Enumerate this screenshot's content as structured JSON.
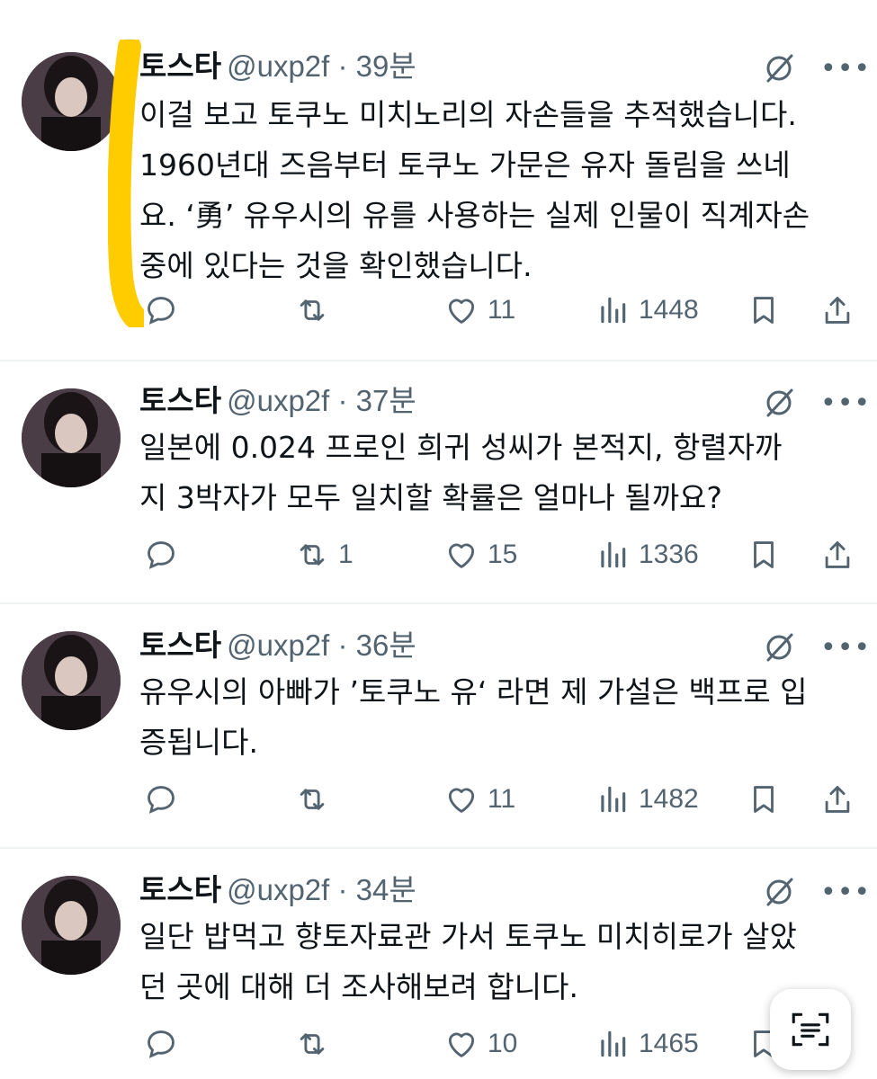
{
  "tweets": [
    {
      "name": "토스타",
      "meta": "@uxp2f · 39분",
      "text_lines": [
        "이걸 보고 토쿠노 미치노리의 자손들을 추적했습니다.",
        "1960년대 즈음부터 토쿠노 가문은 유자 돌림을 쓰네",
        "요. ‘勇’ 유우시의 유를 사용하는 실제 인물이 직계자손",
        "중에 있다는 것을 확인했습니다."
      ],
      "replies": "",
      "retweets": "",
      "likes": "11",
      "views": "1448"
    },
    {
      "name": "토스타",
      "meta": "@uxp2f · 37분",
      "text_lines": [
        "일본에 0.024 프로인 희귀 성씨가 본적지, 항렬자까",
        "지 3박자가 모두 일치할 확률은 얼마나 될까요?"
      ],
      "replies": "",
      "retweets": "1",
      "likes": "15",
      "views": "1336"
    },
    {
      "name": "토스타",
      "meta": "@uxp2f · 36분",
      "text_lines": [
        "유우시의 아빠가 ’토쿠노 유‘ 라면 제 가설은 백프로 입",
        "증됩니다."
      ],
      "replies": "",
      "retweets": "",
      "likes": "11",
      "views": "1482"
    },
    {
      "name": "토스타",
      "meta": "@uxp2f · 34분",
      "text_lines": [
        "일단 밥먹고 향토자료관 가서 토쿠노 미치히로가 살았",
        "던 곳에 대해 더 조사해보려 합니다."
      ],
      "replies": "",
      "retweets": "",
      "likes": "10",
      "views": "1465"
    }
  ],
  "icons": {
    "reply": "reply-icon",
    "retweet": "retweet-icon",
    "like": "heart-icon",
    "views": "views-icon",
    "bookmark": "bookmark-icon",
    "share": "share-icon",
    "grok": "grok-icon",
    "more": "more-icon",
    "scan": "text-scan-icon"
  },
  "colors": {
    "highlight": "#FFCC00",
    "secondary_text": "#536471",
    "divider": "#EFF3F4"
  }
}
